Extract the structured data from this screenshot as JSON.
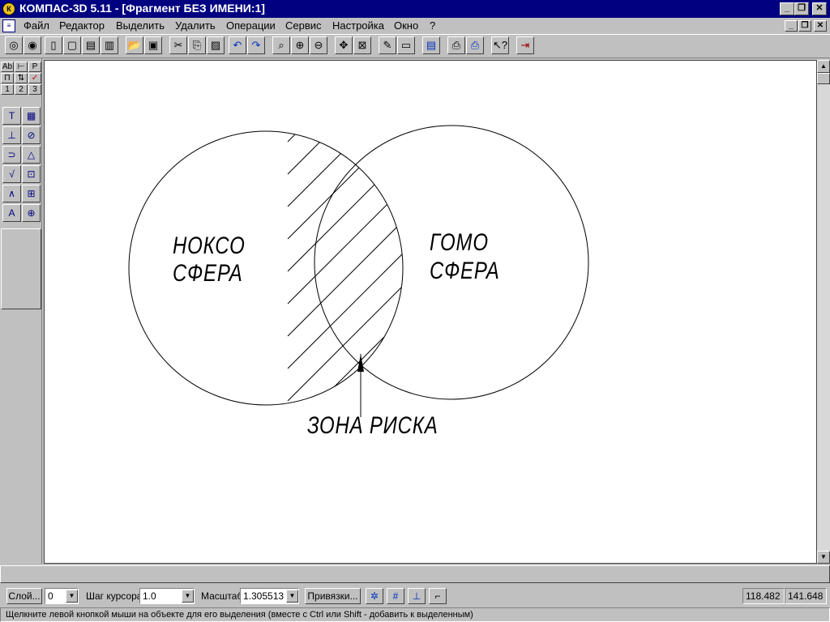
{
  "window": {
    "title": "КОМПАС-3D 5.11 - [Фрагмент БЕЗ ИМЕНИ:1]",
    "minimize_glyph": "_",
    "restore_glyph": "❐",
    "close_glyph": "✕"
  },
  "menu": {
    "items": [
      "Файл",
      "Редактор",
      "Выделить",
      "Удалить",
      "Операции",
      "Сервис",
      "Настройка",
      "Окно",
      "?"
    ]
  },
  "toolbar": {
    "icons": [
      "new-model-icon",
      "new-fragment-icon",
      "new-document-icon",
      "new-sheet-icon",
      "new-spec-icon",
      "new-text-icon",
      "open-icon",
      "save-icon",
      "cut-icon",
      "copy-icon",
      "paste-icon",
      "undo-icon",
      "redo-icon",
      "zoom-icon",
      "zoom-in-icon",
      "zoom-out-icon",
      "pan-icon",
      "fit-icon",
      "refresh-icon",
      "layer-icon",
      "properties-icon",
      "preview-icon",
      "print-icon",
      "help-icon",
      "exit-icon"
    ]
  },
  "left_panel": {
    "mode_row1": [
      "Ab",
      "⊢",
      "P"
    ],
    "mode_row2": [
      "П",
      "⇅",
      "✓"
    ],
    "mode_row3": [
      "1",
      "2",
      "3"
    ],
    "tools": [
      [
        "T",
        "▦"
      ],
      [
        "⊥",
        "⊘"
      ],
      [
        "⊃",
        "△"
      ],
      [
        "√",
        "⊡"
      ],
      [
        "∧",
        "⊞"
      ],
      [
        "A",
        "⊕"
      ]
    ]
  },
  "drawing": {
    "left_label_line1": "НОКСО",
    "left_label_line2": "СФЕРА",
    "right_label_line1": "ГОМО",
    "right_label_line2": "СФЕРА",
    "bottom_label": "ЗОНА РИСКА"
  },
  "bottom": {
    "layer_button": "Слой...",
    "layer_value": "0",
    "step_label": "Шаг курсора",
    "step_value": "1.0",
    "scale_label": "Масштаб",
    "scale_value": "1.305513",
    "snap_button": "Привязки...",
    "coord_x": "118.482",
    "coord_y": "141.648"
  },
  "status": {
    "hint": "Щелкните левой кнопкой мыши на объекте для его выделения (вместе с Ctrl или Shift - добавить к выделенным)"
  },
  "colors": {
    "titlebar": "#000080",
    "face": "#c0c0c0",
    "canvas": "#ffffff"
  }
}
